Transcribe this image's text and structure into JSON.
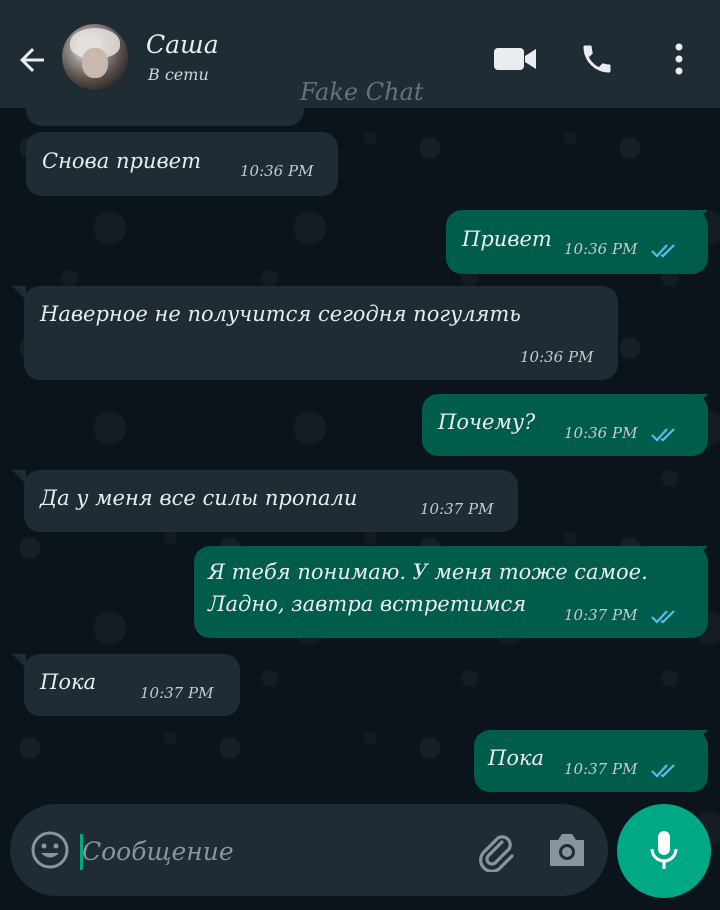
{
  "header": {
    "contact_name": "Саша",
    "status": "В сети",
    "watermark": "Fake Chat"
  },
  "messages": [
    {
      "direction": "in",
      "text": "Снова привет",
      "time": "10:36 PM"
    },
    {
      "direction": "out",
      "text": "Привет",
      "time": "10:36 PM",
      "read": true
    },
    {
      "direction": "in",
      "text": "Наверное не получится сегодня погулять",
      "time": "10:36 PM"
    },
    {
      "direction": "out",
      "text": "Почему?",
      "time": "10:36 PM",
      "read": true
    },
    {
      "direction": "in",
      "text": "Да у меня все силы пропали",
      "time": "10:37 PM"
    },
    {
      "direction": "out",
      "text_line1": "Я тебя понимаю. У меня тоже самое.",
      "text_line2": "Ладно, завтра встретимся",
      "time": "10:37 PM",
      "read": true
    },
    {
      "direction": "in",
      "text": "Пока",
      "time": "10:37 PM"
    },
    {
      "direction": "out",
      "text": "Пока",
      "time": "10:37 PM",
      "read": true
    }
  ],
  "input": {
    "placeholder": "Сообщение"
  },
  "icons": {
    "back": "arrow-left",
    "video": "video-camera",
    "call": "phone",
    "menu": "more-vertical",
    "emoji": "smiley",
    "attach": "paperclip",
    "camera": "camera",
    "mic": "microphone",
    "read_ticks": "double-check"
  },
  "colors": {
    "header_bg": "#1f2c34",
    "chat_bg": "#0b141a",
    "incoming_bubble": "#1f2c34",
    "outgoing_bubble": "#005c4b",
    "accent": "#00a884",
    "read_ticks": "#53bdeb"
  }
}
